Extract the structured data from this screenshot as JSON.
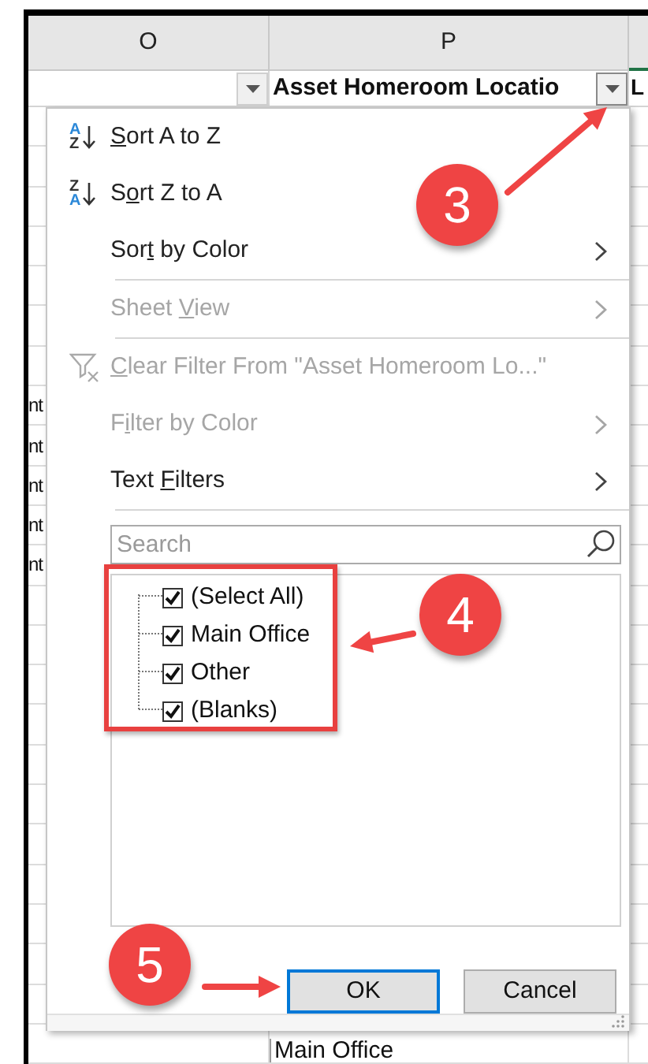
{
  "columns": [
    {
      "letter": "O"
    },
    {
      "letter": "P"
    }
  ],
  "header_row": {
    "column_p": "Asset Homeroom Locatio",
    "column_q": "L"
  },
  "filter_buttons": [
    {
      "active": false
    },
    {
      "active": true
    }
  ],
  "cells_left": [
    "nt",
    "nt",
    "nt",
    "nt",
    "nt"
  ],
  "bottom_cell": "Main Office",
  "menu": {
    "items": [
      {
        "kind": "sort_ascending",
        "icon_top": "A",
        "icon_bottom": "Z",
        "key": "S",
        "post": "ort A to Z",
        "disabled": false
      },
      {
        "kind": "sort_descending",
        "icon_top": "Z",
        "icon_bottom": "A",
        "pre": "S",
        "key": "o",
        "post": "rt Z to A",
        "disabled": false
      },
      {
        "kind": "submenu",
        "pre": "Sor",
        "key": "t",
        "post": " by Color",
        "disabled": false,
        "divider_after": true
      },
      {
        "kind": "submenu",
        "pre": "Sheet ",
        "key": "V",
        "post": "iew",
        "disabled": true,
        "divider_after": true
      },
      {
        "kind": "clear_filter",
        "key": "C",
        "post": "lear Filter From \"Asset Homeroom Lo...\"",
        "disabled": true
      },
      {
        "kind": "submenu",
        "pre": "F",
        "key": "i",
        "post": "lter by Color",
        "disabled": true
      },
      {
        "kind": "submenu",
        "pre": "Text ",
        "key": "F",
        "post": "ilters",
        "disabled": false,
        "divider_after": true
      }
    ],
    "search": {
      "placeholder": "Search"
    },
    "values": [
      {
        "label": "(Select All)",
        "checked": true
      },
      {
        "label": "Main Office",
        "checked": true
      },
      {
        "label": "Other",
        "checked": true
      },
      {
        "label": "(Blanks)",
        "checked": true
      }
    ],
    "buttons": [
      {
        "label": "OK",
        "default": true
      },
      {
        "label": "Cancel",
        "default": false
      }
    ]
  },
  "callouts": [
    {
      "label": "3"
    },
    {
      "label": "4"
    },
    {
      "label": "5"
    }
  ]
}
